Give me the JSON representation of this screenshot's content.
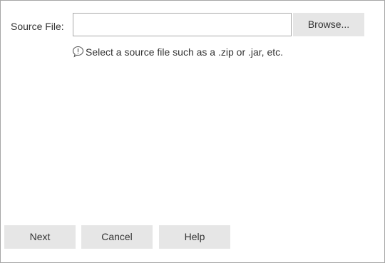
{
  "form": {
    "source_file_label": "Source File:",
    "source_file_value": "",
    "source_file_placeholder": "",
    "browse_label": "Browse...",
    "hint_icon": "info-bubble-icon",
    "hint_text": "Select a source file such as a .zip or .jar, etc."
  },
  "footer": {
    "next_label": "Next",
    "cancel_label": "Cancel",
    "help_label": "Help"
  },
  "colors": {
    "button_bg": "#e6e6e6",
    "border": "#a9a9a9",
    "text": "#333333"
  }
}
